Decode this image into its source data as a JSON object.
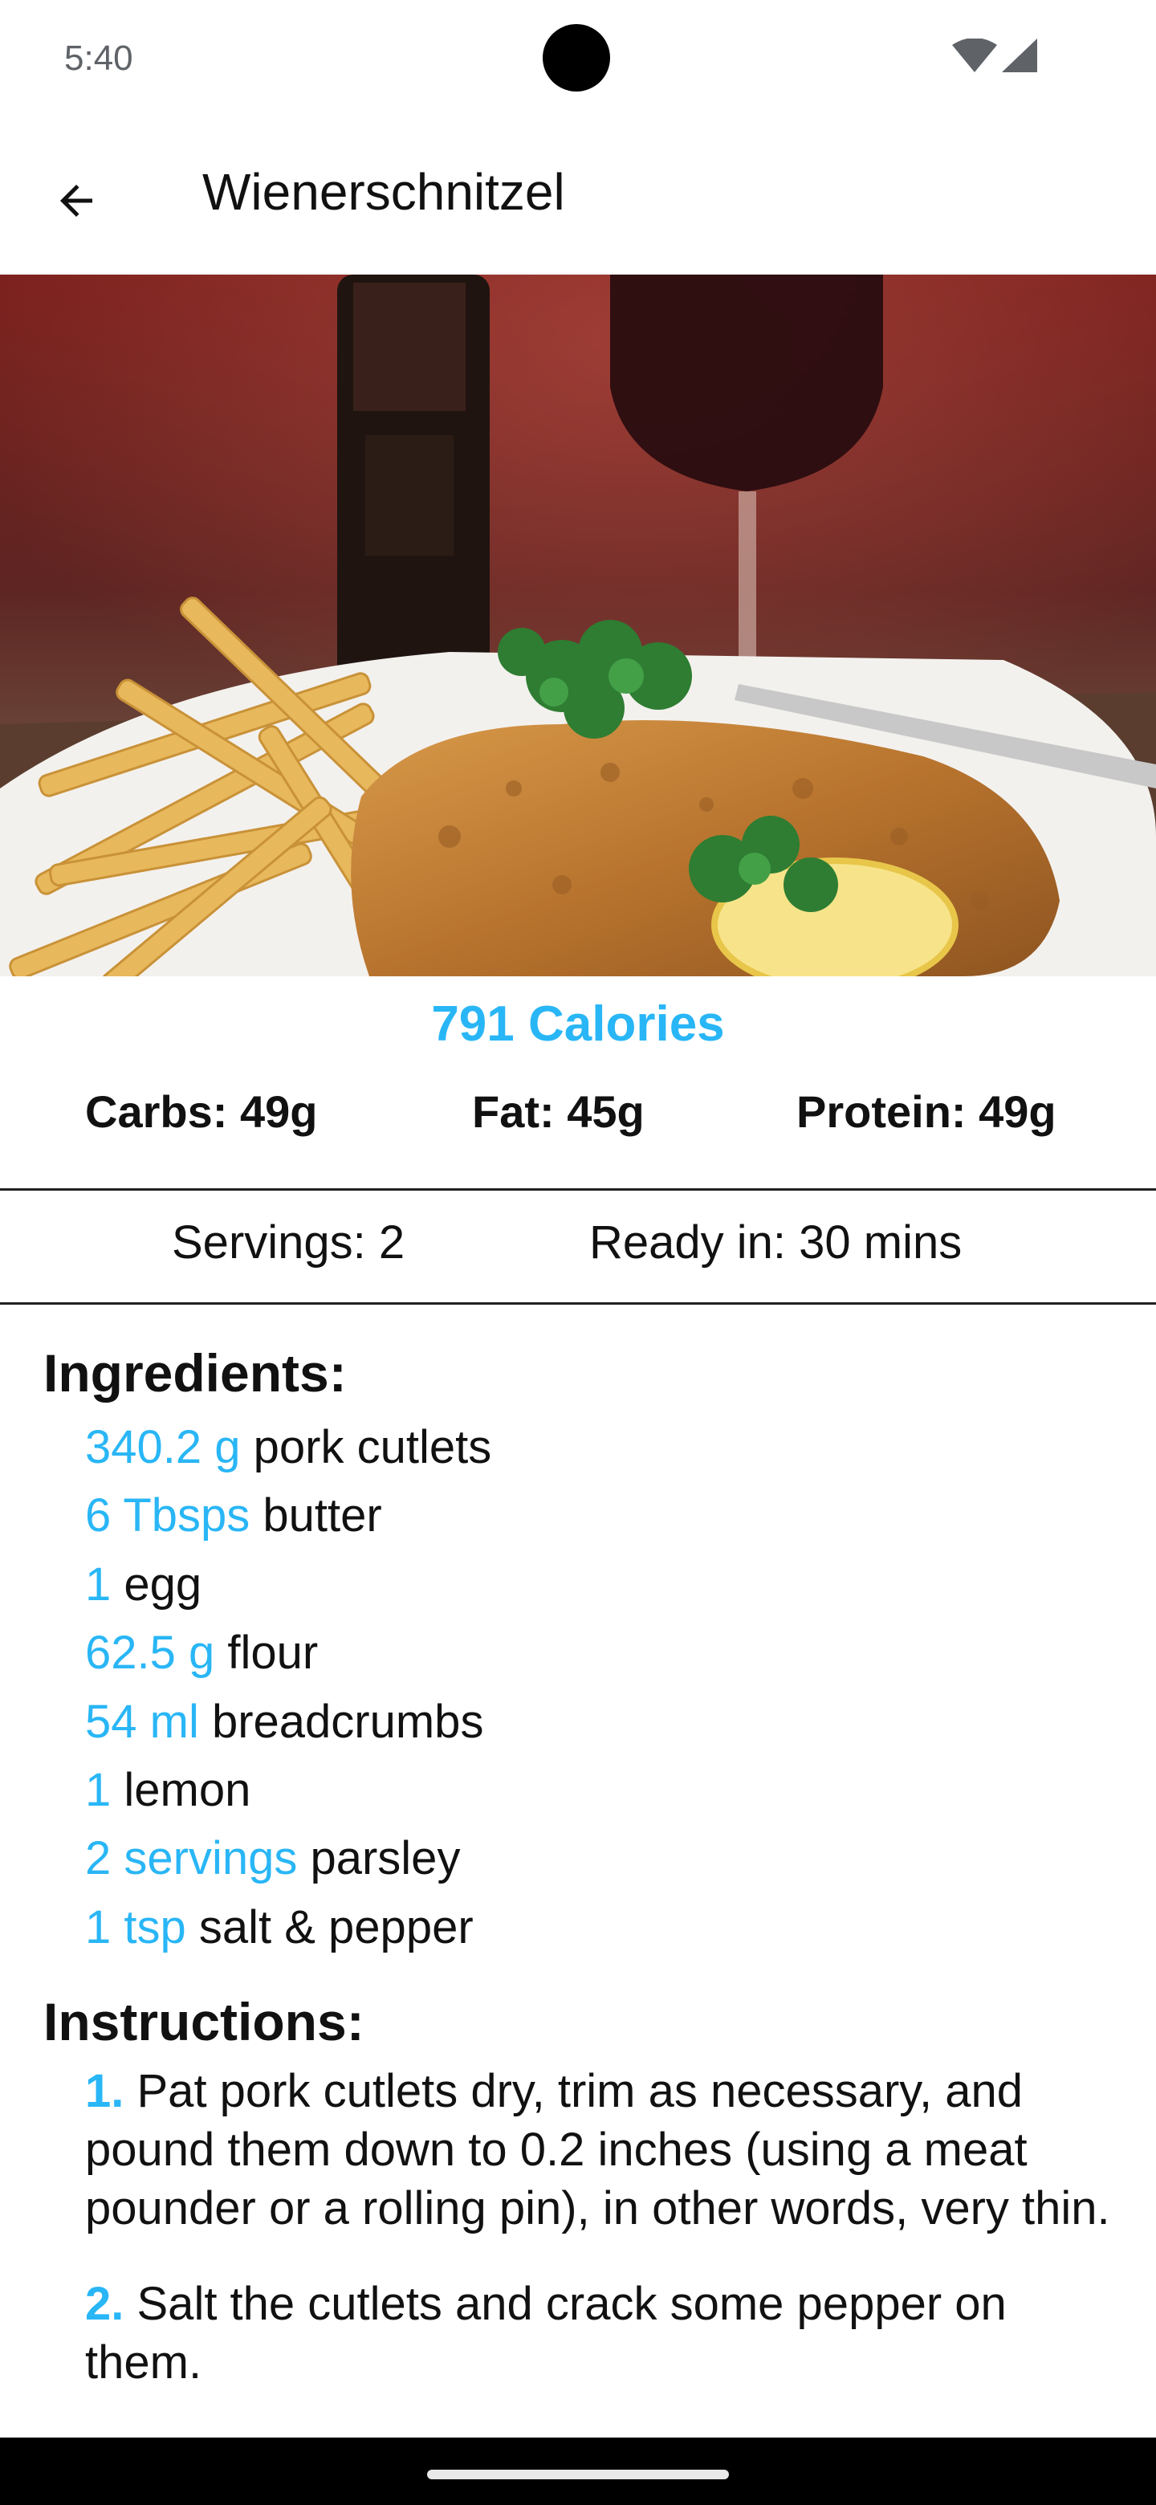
{
  "status_bar": {
    "time": "5:40",
    "icons": [
      "wifi-icon",
      "cell-signal-icon"
    ]
  },
  "app_bar": {
    "back_icon": "arrow-left-icon",
    "title": "Wienerschnitzel"
  },
  "hero_image": {
    "description": "plate-of-wienerschnitzel-with-fries-lemon-parsley-and-red-wine"
  },
  "nutrition": {
    "calories": "791 Calories",
    "carbs": "Carbs: 49g",
    "fat": "Fat: 45g",
    "protein": "Protein: 49g"
  },
  "meta": {
    "servings": "Servings: 2",
    "ready_in": "Ready in: 30 mins"
  },
  "ingredients": {
    "heading": "Ingredients:",
    "items": [
      {
        "qty": "340.2 g",
        "name": "pork cutlets"
      },
      {
        "qty": "6 Tbsps",
        "name": "butter"
      },
      {
        "qty": "1 ",
        "name": "egg"
      },
      {
        "qty": "62.5 g",
        "name": "flour"
      },
      {
        "qty": "54 ml",
        "name": "breadcrumbs"
      },
      {
        "qty": "1 ",
        "name": "lemon"
      },
      {
        "qty": "2 servings",
        "name": "parsley"
      },
      {
        "qty": "1 tsp",
        "name": "salt & pepper"
      }
    ]
  },
  "instructions": {
    "heading": "Instructions:",
    "steps": [
      {
        "num": "1.",
        "text": "Pat pork cutlets dry, trim as necessary, and pound them down to 0.2 inches (using a meat pounder or a rolling pin), in other words, very thin."
      },
      {
        "num": "2.",
        "text": "Salt the cutlets and crack some pepper on them."
      }
    ]
  },
  "colors": {
    "accent": "#29b6f6",
    "text": "#111111",
    "background": "#ffffff"
  }
}
